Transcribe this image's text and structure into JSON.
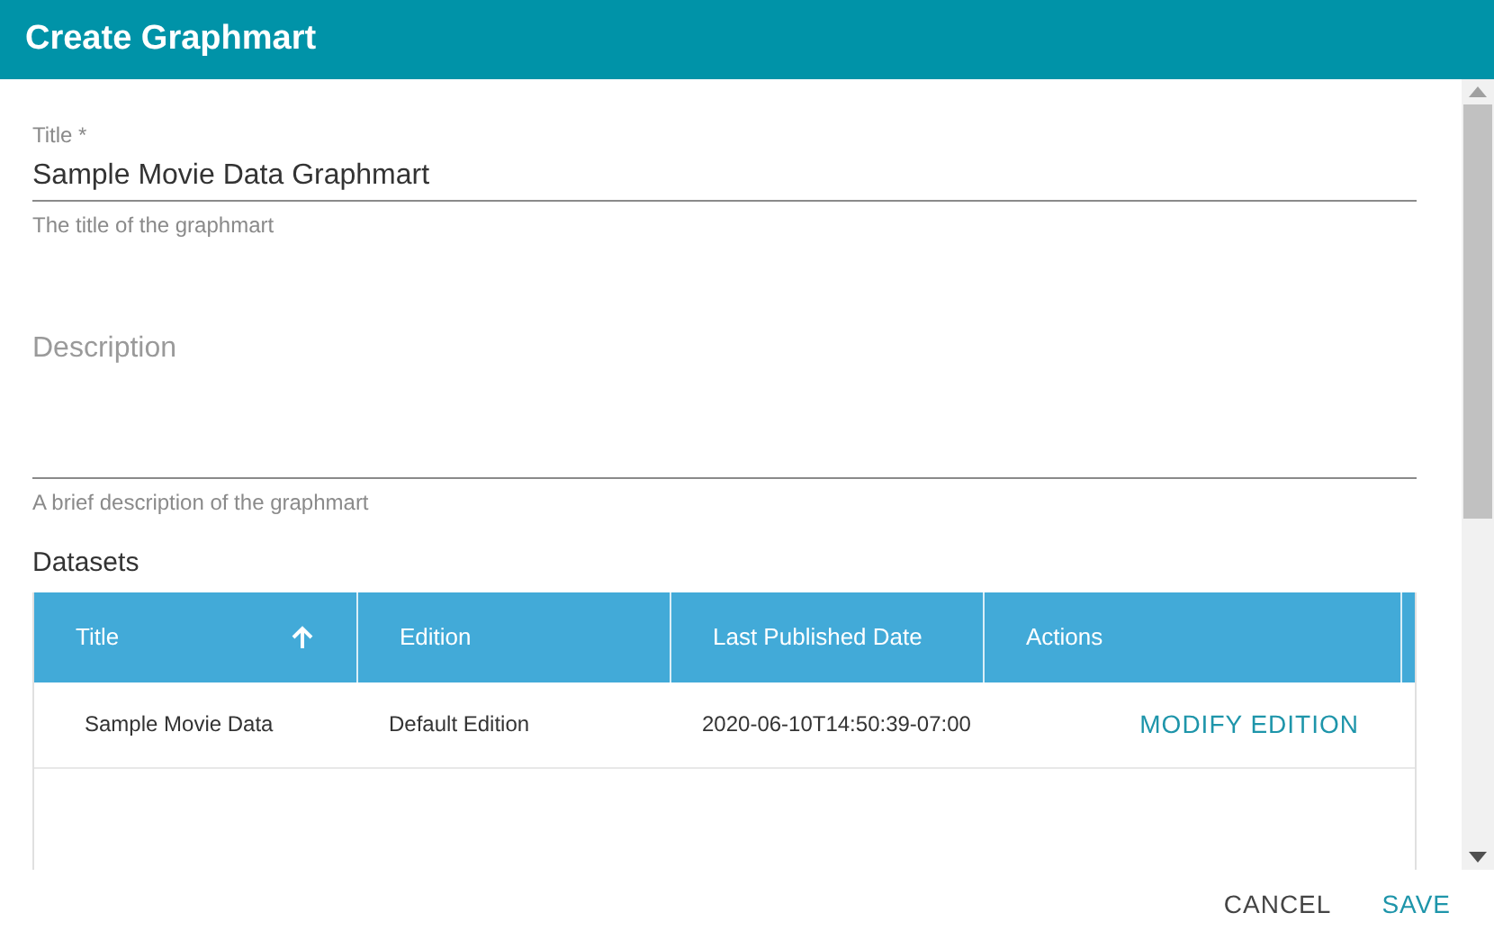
{
  "dialog": {
    "title": "Create Graphmart"
  },
  "fields": [
    {
      "kind": "input",
      "label": "Title *",
      "value": "Sample Movie Data Graphmart",
      "hint": "The title of the graphmart"
    },
    {
      "kind": "textarea",
      "placeholder": "Description",
      "hint": "A brief description of the graphmart"
    }
  ],
  "datasets": {
    "heading": "Datasets",
    "columns": [
      {
        "label": "Title",
        "sorted": true
      },
      {
        "label": "Edition",
        "sorted": false
      },
      {
        "label": "Last Published Date",
        "sorted": false
      },
      {
        "label": "Actions",
        "sorted": false
      }
    ],
    "rows": [
      {
        "cells": [
          "Sample Movie Data",
          "Default Edition",
          "2020-06-10T14:50:39-07:00"
        ],
        "action": "MODIFY EDITION"
      }
    ]
  },
  "buttons": [
    "CANCEL",
    "SAVE"
  ]
}
